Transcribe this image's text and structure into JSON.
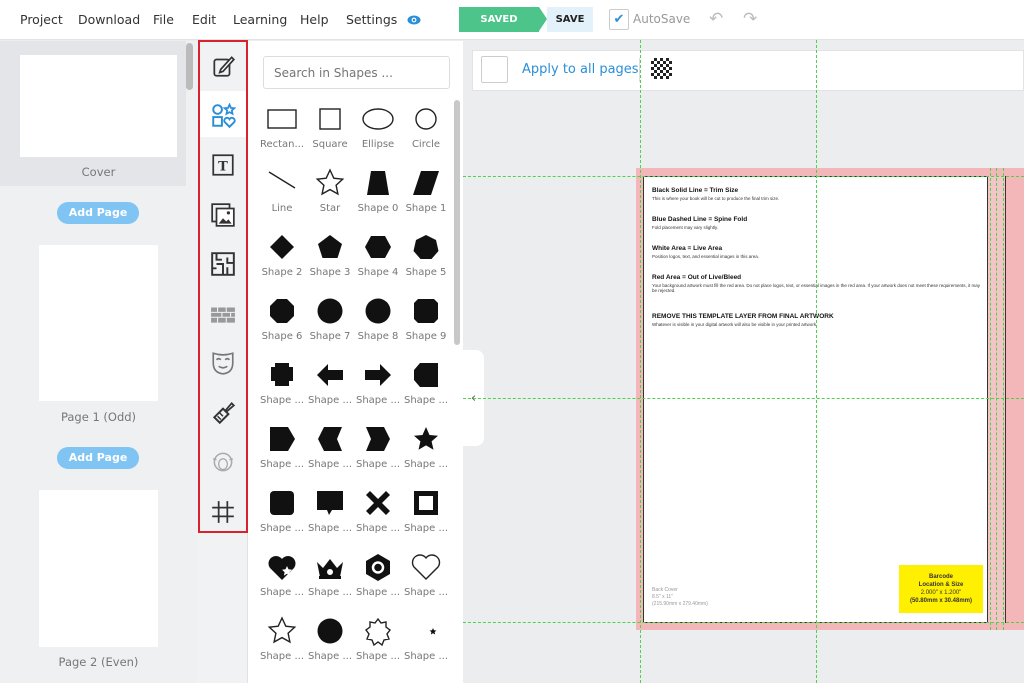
{
  "menu": [
    "Project",
    "Download",
    "File",
    "Edit",
    "Learning",
    "Help",
    "Settings"
  ],
  "toolbar": {
    "saved": "SAVED",
    "save": "SAVE",
    "autosave": "AutoSave",
    "autosave_checked": true
  },
  "pages": {
    "items": [
      {
        "label": "Cover"
      },
      {
        "label": "Page 1 (Odd)"
      },
      {
        "label": "Page 2 (Even)"
      }
    ],
    "add_page": "Add Page"
  },
  "rail": [
    "edit-icon",
    "shapes-icon",
    "text-icon",
    "images-icon",
    "maze-icon",
    "bricks-icon",
    "mask-icon",
    "brush-icon",
    "sheep-icon",
    "grid-icon"
  ],
  "shapes_panel": {
    "search_placeholder": "Search in Shapes ...",
    "items": [
      {
        "k": "rect",
        "n": "Rectan..."
      },
      {
        "k": "square",
        "n": "Square"
      },
      {
        "k": "ellipse",
        "n": "Ellipse"
      },
      {
        "k": "circle",
        "n": "Circle"
      },
      {
        "k": "line",
        "n": "Line"
      },
      {
        "k": "star-o",
        "n": "Star"
      },
      {
        "k": "trap",
        "n": "Shape 0"
      },
      {
        "k": "para",
        "n": "Shape 1"
      },
      {
        "k": "diamond",
        "n": "Shape 2"
      },
      {
        "k": "pent",
        "n": "Shape 3"
      },
      {
        "k": "hex",
        "n": "Shape 4"
      },
      {
        "k": "hept",
        "n": "Shape 5"
      },
      {
        "k": "oct",
        "n": "Shape 6"
      },
      {
        "k": "non",
        "n": "Shape 7"
      },
      {
        "k": "dec",
        "n": "Shape 8"
      },
      {
        "k": "oct2",
        "n": "Shape 9"
      },
      {
        "k": "cross",
        "n": "Shape ..."
      },
      {
        "k": "arrow-l",
        "n": "Shape ..."
      },
      {
        "k": "arrow-r",
        "n": "Shape ..."
      },
      {
        "k": "tag",
        "n": "Shape ..."
      },
      {
        "k": "pentr",
        "n": "Shape ..."
      },
      {
        "k": "chev-l",
        "n": "Shape ..."
      },
      {
        "k": "chev-r",
        "n": "Shape ..."
      },
      {
        "k": "star-s",
        "n": "Shape ..."
      },
      {
        "k": "rsquare",
        "n": "Shape ..."
      },
      {
        "k": "bubble",
        "n": "Shape ..."
      },
      {
        "k": "x",
        "n": "Shape ..."
      },
      {
        "k": "frame",
        "n": "Shape ..."
      },
      {
        "k": "heart-star",
        "n": "Shape ..."
      },
      {
        "k": "crown",
        "n": "Shape ..."
      },
      {
        "k": "hexnut",
        "n": "Shape ..."
      },
      {
        "k": "heart-o",
        "n": "Shape ..."
      },
      {
        "k": "star-o",
        "n": "Shape ..."
      },
      {
        "k": "scallop",
        "n": "Shape ..."
      },
      {
        "k": "burst-o",
        "n": "Shape ..."
      },
      {
        "k": "crescent",
        "n": "Shape ..."
      }
    ]
  },
  "canvas_toolbar": {
    "apply_all": "Apply to all pages"
  },
  "template": {
    "sections": [
      {
        "title": "Black Solid Line = Trim Size",
        "text": "This is where your book will be cut to produce the final trim size."
      },
      {
        "title": "Blue Dashed Line = Spine Fold",
        "text": "Fold placement may vary slightly."
      },
      {
        "title": "White Area = Live Area",
        "text": "Position logos, text, and essential images in this area."
      },
      {
        "title": "Red Area = Out of Live/Bleed",
        "text": "Your background artwork must fill the red area. Do not place logos, text, or essential images in the red area. If your artwork does not meet these requirements, it may be rejected."
      },
      {
        "title": "REMOVE THIS TEMPLATE LAYER FROM FINAL ARTWORK",
        "text": "Whatever is visible in your digital artwork will also be visible in your printed artwork."
      }
    ],
    "back_cover": [
      "Back Cover",
      "8.5\" x 11\"",
      "(215.90mm x 279.40mm)"
    ],
    "barcode": [
      "Barcode",
      "Location & Size",
      "2.000\" x 1.200\"",
      "(50.80mm x 30.48mm)"
    ]
  },
  "colors": {
    "accent": "#2b8fd8",
    "saved": "#4cc48a",
    "highlight": "#d8222d",
    "bleed": "#f3b7b9",
    "guide": "#4ed24e",
    "barcode": "#ffef00"
  }
}
